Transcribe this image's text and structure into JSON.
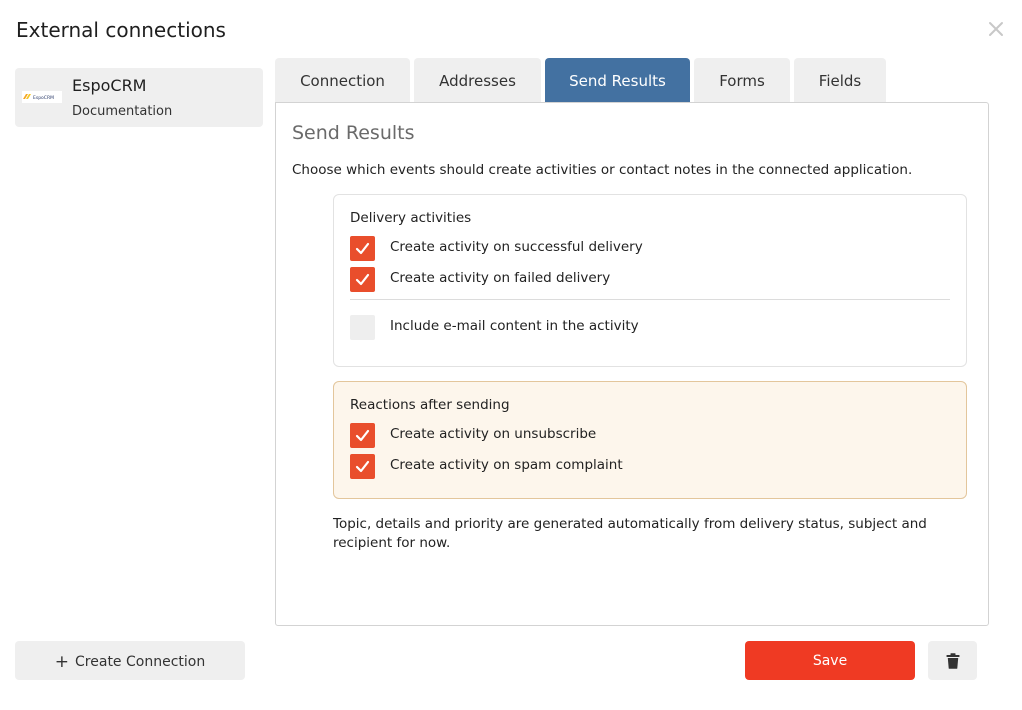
{
  "modal": {
    "title": "External connections",
    "close_icon": "close-icon"
  },
  "sidebar": {
    "connections": [
      {
        "name": "EspoCRM",
        "link": "Documentation",
        "logo_text": "EspoCRM",
        "logo_icon": "espocrm-logo-icon"
      }
    ]
  },
  "tabs": [
    {
      "label": "Connection",
      "active": false
    },
    {
      "label": "Addresses",
      "active": false
    },
    {
      "label": "Send Results",
      "active": true
    },
    {
      "label": "Forms",
      "active": false
    },
    {
      "label": "Fields",
      "active": false
    }
  ],
  "panel": {
    "title": "Send Results",
    "description": "Choose which events should create activities or contact notes in the connected application.",
    "delivery_group": {
      "title": "Delivery activities",
      "options": [
        {
          "label": "Create activity on successful delivery",
          "checked": true
        },
        {
          "label": "Create activity on failed delivery",
          "checked": true
        },
        {
          "label": "Include e-mail content in the activity",
          "checked": false
        }
      ]
    },
    "reactions_group": {
      "title": "Reactions after sending",
      "options": [
        {
          "label": "Create activity on unsubscribe",
          "checked": true
        },
        {
          "label": "Create activity on spam complaint",
          "checked": true
        }
      ]
    },
    "footnote": "Topic, details and priority are generated automatically from delivery status, subject and recipient for now."
  },
  "footer": {
    "create_label": "Create Connection",
    "save_label": "Save",
    "delete_icon": "trash-icon"
  },
  "colors": {
    "accent_tab": "#4371a1",
    "checkbox_on": "#e94e2c",
    "save_button": "#ef3a23",
    "reactions_bg": "#fdf6ec",
    "reactions_border": "#e3c69c"
  }
}
